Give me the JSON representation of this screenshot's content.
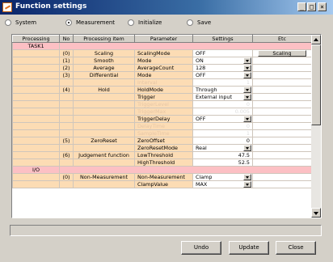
{
  "window": {
    "title": "Function settings",
    "controls": [
      "_",
      "□",
      "×"
    ]
  },
  "mode_radios": [
    {
      "label": "System",
      "selected": false
    },
    {
      "label": "Measurement",
      "selected": true
    },
    {
      "label": "Initialize",
      "selected": false
    },
    {
      "label": "Save",
      "selected": false
    }
  ],
  "table": {
    "headers": [
      "Processing",
      "No",
      "Processing item",
      "Parameter",
      "Settings",
      "Etc"
    ],
    "task1_label": "TASK1",
    "io_label": "I/O",
    "etc_button_label": "Scaling",
    "rows": [
      {
        "no": "(0)",
        "item": "Scaling",
        "param": "ScalingMode",
        "setting": "OFF"
      },
      {
        "no": "(1)",
        "item": "Smooth",
        "param": "Mode",
        "setting": "ON"
      },
      {
        "no": "(2)",
        "item": "Average",
        "param": "AverageCount",
        "setting": "128"
      },
      {
        "no": "(3)",
        "item": "Differential",
        "param": "Mode",
        "setting": "OFF"
      },
      {
        "no": "",
        "item": "",
        "param": "Interval",
        "setting": "1"
      },
      {
        "no": "(4)",
        "item": "Hold",
        "param": "HoldMode",
        "setting": "Through"
      },
      {
        "no": "",
        "item": "",
        "param": "Trigger",
        "setting": "External input"
      },
      {
        "no": "",
        "item": "",
        "param": "TriggerLevel",
        "setting": "0"
      },
      {
        "no": "",
        "item": "",
        "param": "TriggerMax",
        "setting": "0.005"
      },
      {
        "no": "",
        "item": "",
        "param": "TriggerDelay",
        "setting": "OFF"
      },
      {
        "no": "",
        "item": "",
        "param": "DelayTime",
        "setting": "0"
      },
      {
        "no": "",
        "item": "",
        "param": "SampleTime",
        "setting": "1"
      },
      {
        "no": "(5)",
        "item": "ZeroReset",
        "param": "ZeroOffset",
        "setting": "0"
      },
      {
        "no": "",
        "item": "",
        "param": "ZeroResetMode",
        "setting": "Real"
      },
      {
        "no": "(6)",
        "item": "Judgement function",
        "param": "LowThreshold",
        "setting": "47.5"
      },
      {
        "no": "",
        "item": "",
        "param": "HighThreshold",
        "setting": "52.5"
      },
      {
        "no": "(0)",
        "item": "Non-Measurement",
        "param": "Non-Measurement",
        "setting": "Clamp"
      },
      {
        "no": "",
        "item": "",
        "param": "ClampValue",
        "setting": "MAX"
      }
    ]
  },
  "buttons": {
    "undo": "Undo",
    "update": "Update",
    "close": "Close"
  }
}
